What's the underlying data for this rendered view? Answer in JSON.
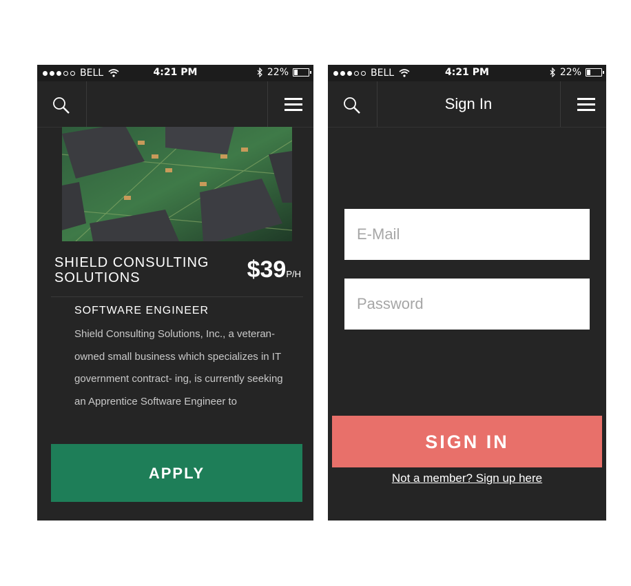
{
  "colors": {
    "background": "#252525",
    "statusbar": "#1c1c1c",
    "apply_green": "#1e7e58",
    "signin_coral": "#e8706a",
    "text_white": "#ffffff",
    "desc_gray": "#c9c9c9"
  },
  "statusbar": {
    "carrier": "BELL",
    "time": "4:21 PM",
    "battery": "22%",
    "battery_level": 0.22,
    "signal_strength": 3,
    "signal_max": 5
  },
  "icons": {
    "search": "search-icon",
    "menu": "hamburger-menu-icon",
    "wifi": "wifi-icon",
    "bluetooth": "bluetooth-icon",
    "battery": "battery-icon"
  },
  "job": {
    "company_line1": "SHIELD CONSULTING",
    "company_line2": "SOLUTIONS",
    "rate_amount": "$39",
    "rate_unit": "P/H",
    "title": "SOFTWARE ENGINEER",
    "description": "Shield Consulting Solutions, Inc., a veteran-owned small business which specializes in IT government contract- ing, is currently seeking an Apprentice Software Engineer to",
    "apply_label": "APPLY"
  },
  "signin": {
    "nav_title": "Sign In",
    "email_placeholder": "E-Mail",
    "password_placeholder": "Password",
    "button_label": "SIGN IN",
    "signup_link": "Not a member? Sign up here"
  }
}
